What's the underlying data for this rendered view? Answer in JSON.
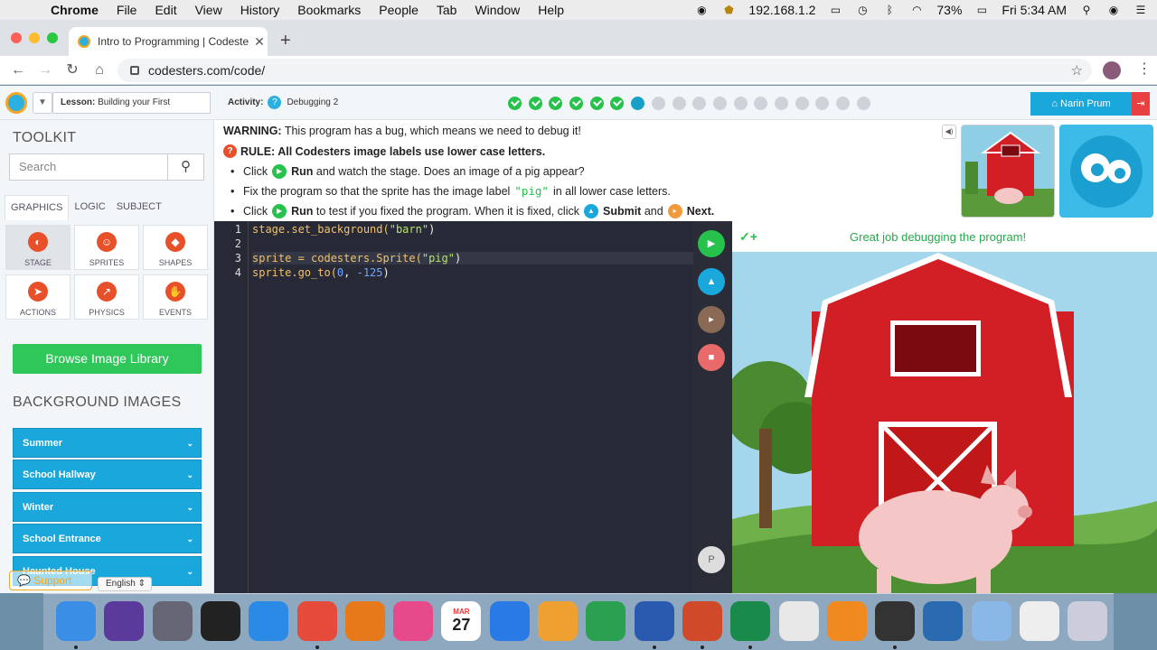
{
  "menubar": {
    "app": "Chrome",
    "items": [
      "File",
      "Edit",
      "View",
      "History",
      "Bookmarks",
      "People",
      "Tab",
      "Window",
      "Help"
    ],
    "ip": "192.168.1.2",
    "battery": "73%",
    "clock": "Fri 5:34 AM"
  },
  "browser": {
    "tab_title": "Intro to Programming | Codeste",
    "url": "codesters.com/code/"
  },
  "topbar": {
    "lesson_prefix": "Lesson:",
    "lesson_name": "Building your First",
    "activity_prefix": "Activity:",
    "activity_name": "Debugging 2",
    "progress": {
      "done": 6,
      "current": 7,
      "total": 18
    },
    "user_button": "Narin Prum"
  },
  "toolkit": {
    "title": "TOOLKIT",
    "search_placeholder": "Search",
    "tabs": [
      "GRAPHICS",
      "LOGIC",
      "SUBJECT"
    ],
    "tools": [
      "STAGE",
      "SPRITES",
      "SHAPES",
      "ACTIONS",
      "PHYSICS",
      "EVENTS"
    ],
    "browse_button": "Browse Image Library",
    "bg_title": "BACKGROUND IMAGES",
    "backgrounds": [
      "Summer",
      "School Hallway",
      "Winter",
      "School Entrance",
      "Haunted House"
    ],
    "support": "Support",
    "language": "English"
  },
  "instructions": {
    "warning_label": "WARNING:",
    "warning_text": "This program has a bug, which means we need to debug it!",
    "rule": "RULE: All Codesters image labels use lower case letters.",
    "b1_a": "Click",
    "b1_run": "Run",
    "b1_b": "and watch the stage. Does an image of a pig appear?",
    "b2_a": "Fix the program so that the sprite has the image label",
    "b2_code": "\"pig\"",
    "b2_b": "in all lower case letters.",
    "b3_a": "Click",
    "b3_run": "Run",
    "b3_b": "to test if you fixed the program. When it is fixed, click",
    "b3_submit": "Submit",
    "b3_and": "and",
    "b3_next": "Next."
  },
  "editor": {
    "line_numbers": [
      "1",
      "2",
      "3",
      "4"
    ],
    "line1_a": "stage.set_background(",
    "line1_s": "\"barn\"",
    "line1_b": ")",
    "line3_a": "sprite = codesters.Sprite(",
    "line3_s": "\"pig\"",
    "line3_b": ")",
    "line4_a": "sprite.go_to(",
    "line4_n1": "0",
    "line4_c": ", ",
    "line4_n2": "-125",
    "line4_b": ")"
  },
  "stage": {
    "message": "Great job debugging the program!",
    "check": "✓+"
  },
  "side_buttons": [
    "P"
  ],
  "colors": {
    "accent": "#1aa7dc",
    "success": "#27c24c",
    "barn_red": "#d21f26"
  },
  "dock": [
    "finder-icon",
    "siri-icon",
    "launchpad-icon",
    "photo-booth-icon",
    "safari-icon",
    "chrome-icon",
    "firefox-icon",
    "itunes-icon",
    "calendar-icon",
    "keynote-icon",
    "pages-icon",
    "numbers-icon",
    "word-icon",
    "powerpoint-icon",
    "excel-icon",
    "preview-icon",
    "ibooks-icon",
    "quicktime-icon",
    "ilife-icon",
    "folder-icon",
    "screenshot-icon",
    "trash-icon"
  ],
  "calendar": {
    "month": "MAR",
    "day": "27"
  }
}
